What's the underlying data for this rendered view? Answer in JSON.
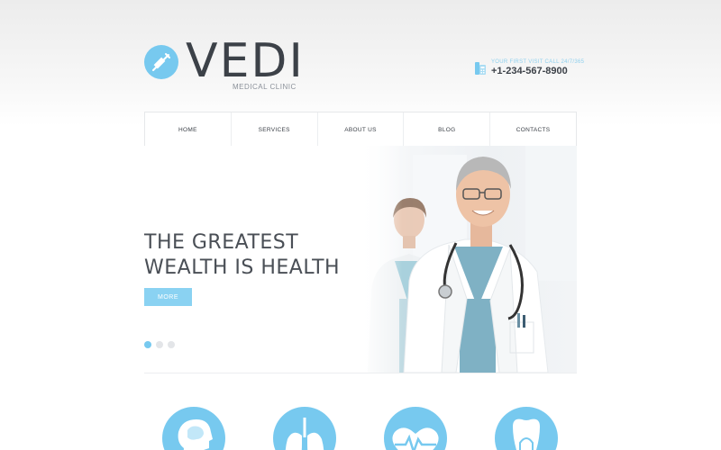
{
  "brand": {
    "name": "VEDI",
    "tagline": "MEDICAL CLINIC",
    "accent_color": "#77c9ef",
    "logo_icon": "syringe-icon"
  },
  "contact": {
    "caption": "YOUR FIRST VISIT CALL 24/7/365",
    "phone": "+1-234-567-8900",
    "icon": "phone-icon"
  },
  "nav": {
    "items": [
      "HOME",
      "SERVICES",
      "ABOUT US",
      "BLOG",
      "CONTACTS"
    ]
  },
  "hero": {
    "title_line1": "THE GREATEST",
    "title_line2": "WEALTH IS HEALTH",
    "button_label": "MORE",
    "slides": 3,
    "active_slide": 1
  },
  "services": {
    "icons": [
      "brain-head-icon",
      "lungs-icon",
      "heart-pulse-icon",
      "tooth-icon"
    ]
  }
}
